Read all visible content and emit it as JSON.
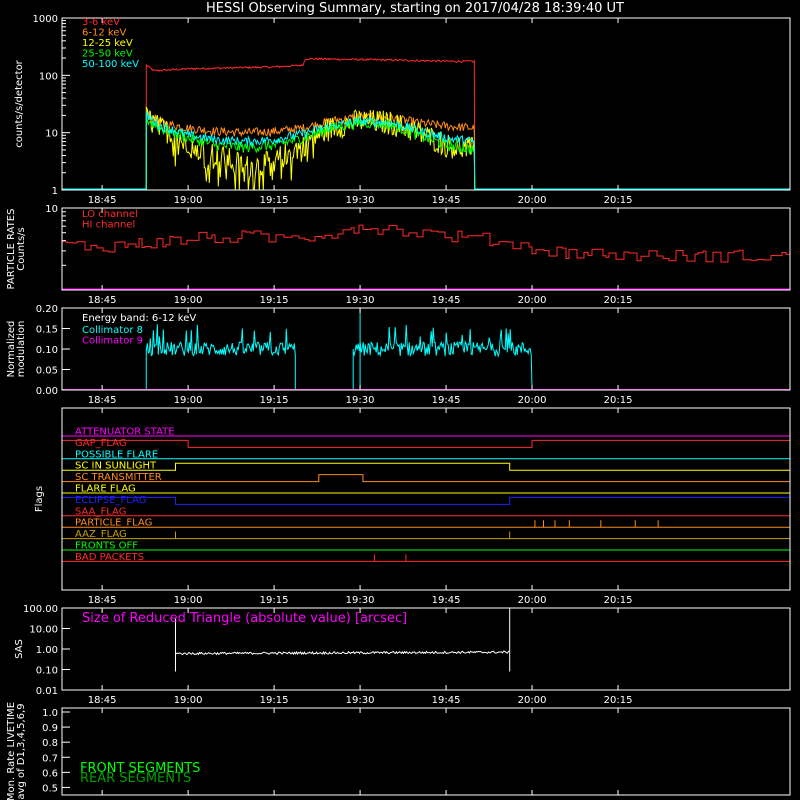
{
  "title": "HESSI Observing Summary, starting on 2017/04/28 18:39:40 UT",
  "time_axis": {
    "range_min": [
      -2,
      125
    ],
    "ticks": [
      {
        "label": "18:45",
        "min": 5
      },
      {
        "label": "19:00",
        "min": 20
      },
      {
        "label": "19:15",
        "min": 35
      },
      {
        "label": "19:30",
        "min": 50
      },
      {
        "label": "19:45",
        "min": 65
      },
      {
        "label": "20:00",
        "min": 80
      },
      {
        "label": "20:15",
        "min": 95
      }
    ]
  },
  "colors": {
    "frame": "#ffffff",
    "red": "#ff2a2a",
    "orange": "#ff8c1a",
    "yellow": "#ffff00",
    "green": "#00ff00",
    "cyan": "#00ffff",
    "magenta": "#ff00ff",
    "blue": "#2020ff",
    "olive": "#c8a000",
    "darkgreen": "#00a000"
  },
  "chart_data": [
    {
      "name": "count-rates",
      "type": "line",
      "ylabel": "counts/s/detector",
      "yscale": "log",
      "ylim": [
        1,
        1000
      ],
      "yticks": [
        "1",
        "10",
        "100",
        "1000"
      ],
      "legend": [
        "3-6 keV",
        "6-12 keV",
        "12-25 keV",
        "25-50 keV",
        "50-100 keV"
      ],
      "series": [
        {
          "name": "3-6 keV",
          "color": "red",
          "t": [
            12.7,
            14,
            20,
            35,
            40,
            40.5,
            55,
            67,
            70
          ],
          "y": [
            150,
            120,
            130,
            140,
            150,
            195,
            185,
            175,
            175
          ]
        },
        {
          "name": "6-12 keV",
          "color": "orange",
          "t": [
            12.7,
            15,
            20,
            25,
            30,
            35,
            40,
            45,
            50,
            55,
            60,
            65,
            70
          ],
          "y": [
            22,
            15,
            12,
            10.5,
            10,
            10.5,
            12,
            16,
            19,
            18,
            15,
            13,
            12
          ]
        },
        {
          "name": "12-25 keV",
          "color": "yellow",
          "t": [
            12.7,
            15,
            20,
            25,
            30,
            35,
            40,
            45,
            50,
            55,
            60,
            65,
            70
          ],
          "y": [
            18,
            12,
            7,
            4,
            2.5,
            3,
            6,
            12,
            16,
            15,
            10,
            6,
            5
          ]
        },
        {
          "name": "25-50 keV",
          "color": "green",
          "t": [
            12.7,
            15,
            20,
            25,
            30,
            35,
            40,
            45,
            50,
            55,
            60,
            65,
            70
          ],
          "y": [
            17,
            12,
            8,
            6,
            5.5,
            6,
            8,
            12,
            15,
            14,
            9,
            6,
            5
          ]
        },
        {
          "name": "50-100 keV",
          "color": "cyan",
          "t": [
            12.7,
            15,
            20,
            25,
            30,
            35,
            40,
            45,
            50,
            55,
            60,
            65,
            70
          ],
          "y": [
            20,
            13,
            9,
            7.5,
            7,
            7.5,
            9.5,
            13,
            16,
            15,
            11,
            8,
            7
          ]
        }
      ]
    },
    {
      "name": "particle-rates",
      "type": "line",
      "ylabel": "PARTICLE RATES\nCounts/s",
      "yscale": "log",
      "ylim": [
        1,
        10
      ],
      "yticks": [
        "10"
      ],
      "legend": [
        "LO channel",
        "HI channel"
      ],
      "series": [
        {
          "name": "HI channel",
          "color": "red",
          "t": [
            -2,
            5,
            10,
            15,
            20,
            30,
            35,
            40,
            45,
            50,
            55,
            60,
            65,
            70,
            75,
            80,
            85,
            90,
            95,
            100,
            105,
            110,
            115,
            125
          ],
          "y": [
            3.5,
            3.4,
            3.6,
            3.8,
            4.2,
            4.5,
            4.3,
            4.4,
            5.0,
            6.0,
            5.5,
            5.0,
            4.6,
            4.3,
            3.8,
            3.2,
            2.9,
            2.8,
            2.7,
            2.6,
            2.6,
            2.6,
            2.6,
            2.6
          ]
        }
      ]
    },
    {
      "name": "modulation",
      "type": "line",
      "ylabel": "Normalized\nmodulation",
      "ylim": [
        0,
        0.2
      ],
      "yticks": [
        "0.00",
        "0.05",
        "0.10",
        "0.15",
        "0.20"
      ],
      "annotation": "Energy band: 6-12 keV",
      "legend": [
        "Collimator 8",
        "Collimator 9"
      ],
      "series": [
        {
          "name": "Collimator 8",
          "color": "cyan",
          "segments": [
            [
              12.7,
              38.7
            ],
            [
              48.8,
              80.0
            ]
          ],
          "level": 0.1,
          "spike": [
            {
              "t": 50.0,
              "y": 0.21
            }
          ]
        },
        {
          "name": "Collimator 9",
          "color": "magenta",
          "level": 0.0
        }
      ]
    },
    {
      "name": "flags",
      "type": "table",
      "ylabel": "Flags",
      "flags": [
        {
          "label": "ATTENUATOR STATE",
          "color": "magenta",
          "high": []
        },
        {
          "label": "GAP_FLAG",
          "color": "red",
          "high": [
            [
              -2,
              20.0
            ],
            [
              80.0,
              125
            ]
          ]
        },
        {
          "label": "POSSIBLE FLARE",
          "color": "cyan",
          "high": []
        },
        {
          "label": "SC IN SUNLIGHT",
          "color": "yellow",
          "high": [
            [
              17.8,
              76.1
            ]
          ]
        },
        {
          "label": "SC TRANSMITTER",
          "color": "orange",
          "high": [
            [
              42.8,
              50.5
            ]
          ]
        },
        {
          "label": "FLARE FLAG",
          "color": "yellow",
          "high": []
        },
        {
          "label": "ECLIPSE_FLAG",
          "color": "blue",
          "high": [
            [
              -2,
              17.8
            ],
            [
              76.1,
              125
            ]
          ]
        },
        {
          "label": "SAA_FLAG",
          "color": "red",
          "high": []
        },
        {
          "label": "PARTICLE_FLAG",
          "color": "orange",
          "high": [],
          "ticks": [
            80.5,
            82,
            84,
            86.5,
            92,
            98,
            102
          ]
        },
        {
          "label": "AAZ_FLAG",
          "color": "olive",
          "high": [],
          "ticks": [
            17.8,
            76.1
          ]
        },
        {
          "label": "FRONTS OFF",
          "color": "green",
          "high": []
        },
        {
          "label": "BAD PACKETS",
          "color": "red",
          "high": [],
          "ticks": [
            52.5,
            58.0
          ]
        }
      ]
    },
    {
      "name": "sas",
      "type": "line",
      "ylabel": "SAS",
      "yscale": "log",
      "ylim": [
        0.01,
        100
      ],
      "yticks": [
        "0.01",
        "0.10",
        "1.00",
        "10.00",
        "100.00"
      ],
      "legend": [
        "Size of Reduced Triangle (absolute value) [arcsec]"
      ],
      "series": [
        {
          "name": "Size of Reduced Triangle (absolute value) [arcsec]",
          "color": "white",
          "t": [
            17.8,
            76.1
          ],
          "y": [
            0.6,
            0.7
          ],
          "spikes": [
            {
              "t": 17.8,
              "y": 30
            },
            {
              "t": 76.1,
              "y": 100
            }
          ]
        }
      ]
    },
    {
      "name": "livetime",
      "type": "line",
      "ylabel": "Mon. Rate LIVETIME\navg of D1,3,4,5,6,9",
      "ylim": [
        0,
        1
      ],
      "yticks": [
        "0.5",
        "0.6",
        "0.7",
        "0.8",
        "0.9",
        "1.0"
      ],
      "legend": [
        "FRONT SEGMENTS",
        "REAR SEGMENTS"
      ],
      "series": []
    }
  ]
}
